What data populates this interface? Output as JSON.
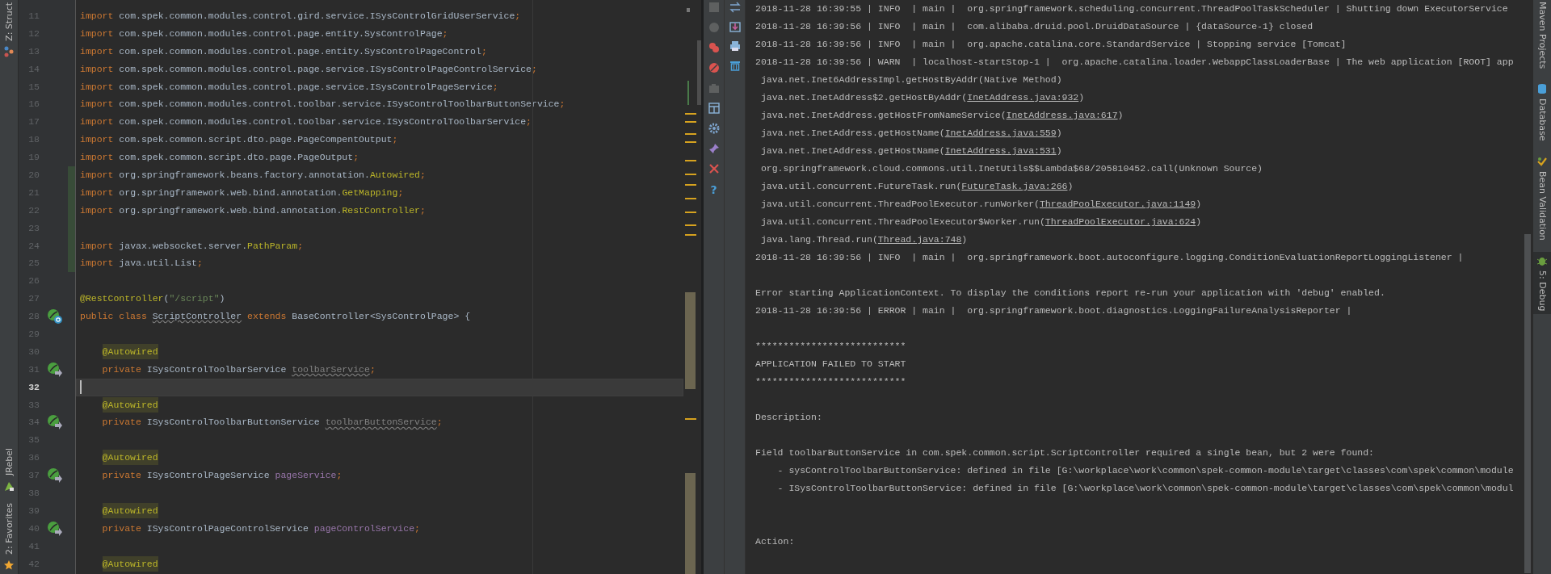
{
  "left_tool_strip": [
    {
      "label": "Z: Struct",
      "kind": "structure"
    },
    {
      "label": "JRebel",
      "kind": "jrebel"
    },
    {
      "label": "2: Favorites",
      "kind": "favorites"
    }
  ],
  "editor": {
    "lines": [
      {
        "number": "11",
        "changed": false,
        "current": false,
        "tokens": [
          {
            "kind": "keyword",
            "text": "import"
          },
          {
            "kind": "plain",
            "text": " com.spek.common.modules.control.gird.service.ISysControlGridUserService"
          },
          {
            "kind": "keyword",
            "text": ";"
          }
        ]
      },
      {
        "number": "12",
        "changed": false,
        "current": false,
        "tokens": [
          {
            "kind": "keyword",
            "text": "import"
          },
          {
            "kind": "plain",
            "text": " com.spek.common.modules.control.page.entity.SysControlPage"
          },
          {
            "kind": "keyword",
            "text": ";"
          }
        ]
      },
      {
        "number": "13",
        "changed": false,
        "current": false,
        "tokens": [
          {
            "kind": "keyword",
            "text": "import"
          },
          {
            "kind": "plain",
            "text": " com.spek.common.modules.control.page.entity.SysControlPageControl"
          },
          {
            "kind": "keyword",
            "text": ";"
          }
        ]
      },
      {
        "number": "14",
        "changed": false,
        "current": false,
        "tokens": [
          {
            "kind": "keyword",
            "text": "import"
          },
          {
            "kind": "plain",
            "text": " com.spek.common.modules.control.page.service.ISysControlPageControlService"
          },
          {
            "kind": "keyword",
            "text": ";"
          }
        ]
      },
      {
        "number": "15",
        "changed": false,
        "current": false,
        "tokens": [
          {
            "kind": "keyword",
            "text": "import"
          },
          {
            "kind": "plain",
            "text": " com.spek.common.modules.control.page.service.ISysControlPageService"
          },
          {
            "kind": "keyword",
            "text": ";"
          }
        ]
      },
      {
        "number": "16",
        "changed": false,
        "current": false,
        "tokens": [
          {
            "kind": "keyword",
            "text": "import"
          },
          {
            "kind": "plain",
            "text": " com.spek.common.modules.control.toolbar.service.ISysControlToolbarButtonService"
          },
          {
            "kind": "keyword",
            "text": ";"
          }
        ]
      },
      {
        "number": "17",
        "changed": false,
        "current": false,
        "tokens": [
          {
            "kind": "keyword",
            "text": "import"
          },
          {
            "kind": "plain",
            "text": " com.spek.common.modules.control.toolbar.service.ISysControlToolbarService"
          },
          {
            "kind": "keyword",
            "text": ";"
          }
        ]
      },
      {
        "number": "18",
        "changed": false,
        "current": false,
        "tokens": [
          {
            "kind": "keyword",
            "text": "import"
          },
          {
            "kind": "plain",
            "text": " com.spek.common.script.dto.page.PageCompentOutput"
          },
          {
            "kind": "keyword",
            "text": ";"
          }
        ]
      },
      {
        "number": "19",
        "changed": false,
        "current": false,
        "tokens": [
          {
            "kind": "keyword",
            "text": "import"
          },
          {
            "kind": "plain",
            "text": " com.spek.common.script.dto.page.PageOutput"
          },
          {
            "kind": "keyword",
            "text": ";"
          }
        ]
      },
      {
        "number": "20",
        "changed": true,
        "current": false,
        "tokens": [
          {
            "kind": "keyword",
            "text": "import"
          },
          {
            "kind": "plain",
            "text": " org.springframework.beans.factory.annotation."
          },
          {
            "kind": "annotation",
            "text": "Autowired"
          },
          {
            "kind": "keyword",
            "text": ";"
          }
        ]
      },
      {
        "number": "21",
        "changed": true,
        "current": false,
        "tokens": [
          {
            "kind": "keyword",
            "text": "import"
          },
          {
            "kind": "plain",
            "text": " org.springframework.web.bind.annotation."
          },
          {
            "kind": "annotation",
            "text": "GetMapping"
          },
          {
            "kind": "keyword",
            "text": ";"
          }
        ]
      },
      {
        "number": "22",
        "changed": true,
        "current": false,
        "tokens": [
          {
            "kind": "keyword",
            "text": "import"
          },
          {
            "kind": "plain",
            "text": " org.springframework.web.bind.annotation."
          },
          {
            "kind": "annotation",
            "text": "RestController"
          },
          {
            "kind": "keyword",
            "text": ";"
          }
        ]
      },
      {
        "number": "23",
        "changed": true,
        "current": false
      },
      {
        "number": "24",
        "changed": true,
        "current": false,
        "tokens": [
          {
            "kind": "keyword",
            "text": "import"
          },
          {
            "kind": "plain",
            "text": " javax.websocket.server."
          },
          {
            "kind": "annotation",
            "text": "PathParam"
          },
          {
            "kind": "keyword",
            "text": ";"
          }
        ]
      },
      {
        "number": "25",
        "changed": true,
        "current": false,
        "tokens": [
          {
            "kind": "keyword",
            "text": "import"
          },
          {
            "kind": "plain",
            "text": " java.util.List"
          },
          {
            "kind": "keyword",
            "text": ";"
          }
        ]
      },
      {
        "number": "26",
        "changed": false,
        "current": false
      },
      {
        "number": "27",
        "changed": false,
        "current": false,
        "tokens": [
          {
            "kind": "annotation",
            "text": "@RestController"
          },
          {
            "kind": "plain",
            "text": "("
          },
          {
            "kind": "string",
            "text": "\"/script\""
          },
          {
            "kind": "plain",
            "text": ")"
          }
        ]
      },
      {
        "number": "28",
        "changed": false,
        "current": false,
        "gutter_icon": {
          "kind": "bean_class"
        },
        "tokens": [
          {
            "kind": "keyword",
            "text": "public class "
          },
          {
            "kind": "warned",
            "text": "ScriptController"
          },
          {
            "kind": "keyword",
            "text": " extends "
          },
          {
            "kind": "plain",
            "text": "BaseController<SysControlPage> {"
          }
        ]
      },
      {
        "number": "29",
        "changed": false,
        "current": false
      },
      {
        "number": "30",
        "changed": false,
        "current": false,
        "indented": true,
        "tokens": [
          {
            "kind": "marked",
            "text": "@Autowired"
          }
        ]
      },
      {
        "number": "31",
        "changed": false,
        "current": false,
        "indented": true,
        "gutter_icon": {
          "kind": "bean_field"
        },
        "tokens": [
          {
            "kind": "keyword",
            "text": "private"
          },
          {
            "kind": "plain",
            "text": " ISysControlToolbarService "
          },
          {
            "kind": "unused",
            "text": "toolbarService"
          },
          {
            "kind": "keyword",
            "text": ";"
          }
        ]
      },
      {
        "number": "32",
        "changed": false,
        "current": true
      },
      {
        "number": "33",
        "changed": false,
        "current": false,
        "indented": true,
        "tokens": [
          {
            "kind": "marked",
            "text": "@Autowired"
          }
        ]
      },
      {
        "number": "34",
        "changed": false,
        "current": false,
        "indented": true,
        "gutter_icon": {
          "kind": "bean_field"
        },
        "tokens": [
          {
            "kind": "keyword",
            "text": "private"
          },
          {
            "kind": "plain",
            "text": " ISysControlToolbarButtonService "
          },
          {
            "kind": "unused",
            "text": "toolbarButtonService"
          },
          {
            "kind": "keyword",
            "text": ";"
          }
        ]
      },
      {
        "number": "35",
        "changed": false,
        "current": false
      },
      {
        "number": "36",
        "changed": false,
        "current": false,
        "indented": true,
        "tokens": [
          {
            "kind": "marked",
            "text": "@Autowired"
          }
        ]
      },
      {
        "number": "37",
        "changed": false,
        "current": false,
        "indented": true,
        "gutter_icon": {
          "kind": "bean_field"
        },
        "tokens": [
          {
            "kind": "keyword",
            "text": "private"
          },
          {
            "kind": "plain",
            "text": " ISysControlPageService "
          },
          {
            "kind": "field",
            "text": "pageService"
          },
          {
            "kind": "keyword",
            "text": ";"
          }
        ]
      },
      {
        "number": "38",
        "changed": false,
        "current": false
      },
      {
        "number": "39",
        "changed": false,
        "current": false,
        "indented": true,
        "tokens": [
          {
            "kind": "marked",
            "text": "@Autowired"
          }
        ]
      },
      {
        "number": "40",
        "changed": false,
        "current": false,
        "indented": true,
        "gutter_icon": {
          "kind": "bean_field"
        },
        "tokens": [
          {
            "kind": "keyword",
            "text": "private"
          },
          {
            "kind": "plain",
            "text": " ISysControlPageControlService "
          },
          {
            "kind": "field",
            "text": "pageControlService"
          },
          {
            "kind": "keyword",
            "text": ";"
          }
        ]
      },
      {
        "number": "41",
        "changed": false,
        "current": false
      },
      {
        "number": "42",
        "changed": false,
        "current": false,
        "indented": true,
        "tokens": [
          {
            "kind": "marked",
            "text": "@Autowired"
          }
        ]
      }
    ]
  },
  "debug_toolbar": {
    "help_button": "?"
  },
  "console": {
    "lines": [
      {
        "kind": "log",
        "text": "2018-11-28 16:39:55 | INFO  | main |  org.springframework.scheduling.concurrent.ThreadPoolTaskScheduler | Shutting down ExecutorService"
      },
      {
        "kind": "log",
        "text": "2018-11-28 16:39:56 | INFO  | main |  com.alibaba.druid.pool.DruidDataSource | {dataSource-1} closed"
      },
      {
        "kind": "log",
        "text": "2018-11-28 16:39:56 | INFO  | main |  org.apache.catalina.core.StandardService | Stopping service [Tomcat]"
      },
      {
        "kind": "log",
        "text": "2018-11-28 16:39:56 | WARN  | localhost-startStop-1 |  org.apache.catalina.loader.WebappClassLoaderBase | The web application [ROOT] app"
      },
      {
        "kind": "trace",
        "text": "java.net.Inet6AddressImpl.getHostByAddr(Native Method)"
      },
      {
        "kind": "trace",
        "text": "java.net.InetAddress$2.getHostByAddr(",
        "link": "InetAddress.java:932",
        "after": ")"
      },
      {
        "kind": "trace",
        "text": "java.net.InetAddress.getHostFromNameService(",
        "link": "InetAddress.java:617",
        "after": ")"
      },
      {
        "kind": "trace",
        "text": "java.net.InetAddress.getHostName(",
        "link": "InetAddress.java:559",
        "after": ")"
      },
      {
        "kind": "trace",
        "text": "java.net.InetAddress.getHostName(",
        "link": "InetAddress.java:531",
        "after": ")"
      },
      {
        "kind": "trace",
        "text": "org.springframework.cloud.commons.util.InetUtils$$Lambda$68/205810452.call(Unknown Source)"
      },
      {
        "kind": "trace",
        "text": "java.util.concurrent.FutureTask.run(",
        "link": "FutureTask.java:266",
        "after": ")"
      },
      {
        "kind": "trace",
        "text": "java.util.concurrent.ThreadPoolExecutor.runWorker(",
        "link": "ThreadPoolExecutor.java:1149",
        "after": ")"
      },
      {
        "kind": "trace",
        "text": "java.util.concurrent.ThreadPoolExecutor$Worker.run(",
        "link": "ThreadPoolExecutor.java:624",
        "after": ")"
      },
      {
        "kind": "trace",
        "text": "java.lang.Thread.run(",
        "link": "Thread.java:748",
        "after": ")"
      },
      {
        "kind": "log",
        "text": "2018-11-28 16:39:56 | INFO  | main |  org.springframework.boot.autoconfigure.logging.ConditionEvaluationReportLoggingListener |"
      },
      {
        "kind": "blank"
      },
      {
        "kind": "log",
        "text": "Error starting ApplicationContext. To display the conditions report re-run your application with 'debug' enabled."
      },
      {
        "kind": "log",
        "text": "2018-11-28 16:39:56 | ERROR | main |  org.springframework.boot.diagnostics.LoggingFailureAnalysisReporter |"
      },
      {
        "kind": "blank"
      },
      {
        "kind": "log",
        "text": "***************************"
      },
      {
        "kind": "log",
        "text": "APPLICATION FAILED TO START"
      },
      {
        "kind": "log",
        "text": "***************************"
      },
      {
        "kind": "blank"
      },
      {
        "kind": "log",
        "text": "Description:"
      },
      {
        "kind": "blank"
      },
      {
        "kind": "log",
        "text": "Field toolbarButtonService in com.spek.common.script.ScriptController required a single bean, but 2 were found:"
      },
      {
        "kind": "item",
        "text": "- sysControlToolbarButtonService: defined in file [G:\\workplace\\work\\common\\spek-common-module\\target\\classes\\com\\spek\\common\\module"
      },
      {
        "kind": "item",
        "text": "- ISysControlToolbarButtonService: defined in file [G:\\workplace\\work\\common\\spek-common-module\\target\\classes\\com\\spek\\common\\modul"
      },
      {
        "kind": "blank"
      },
      {
        "kind": "blank"
      },
      {
        "kind": "log",
        "text": "Action:"
      }
    ]
  },
  "right_tool_strip": [
    {
      "label": "Maven Projects",
      "kind": "maven",
      "selected": false
    },
    {
      "label": "Database",
      "kind": "database",
      "selected": false
    },
    {
      "label": "Bean Validation",
      "kind": "validation",
      "selected": false
    },
    {
      "label": "5: Debug",
      "kind": "debug",
      "selected": true
    }
  ]
}
